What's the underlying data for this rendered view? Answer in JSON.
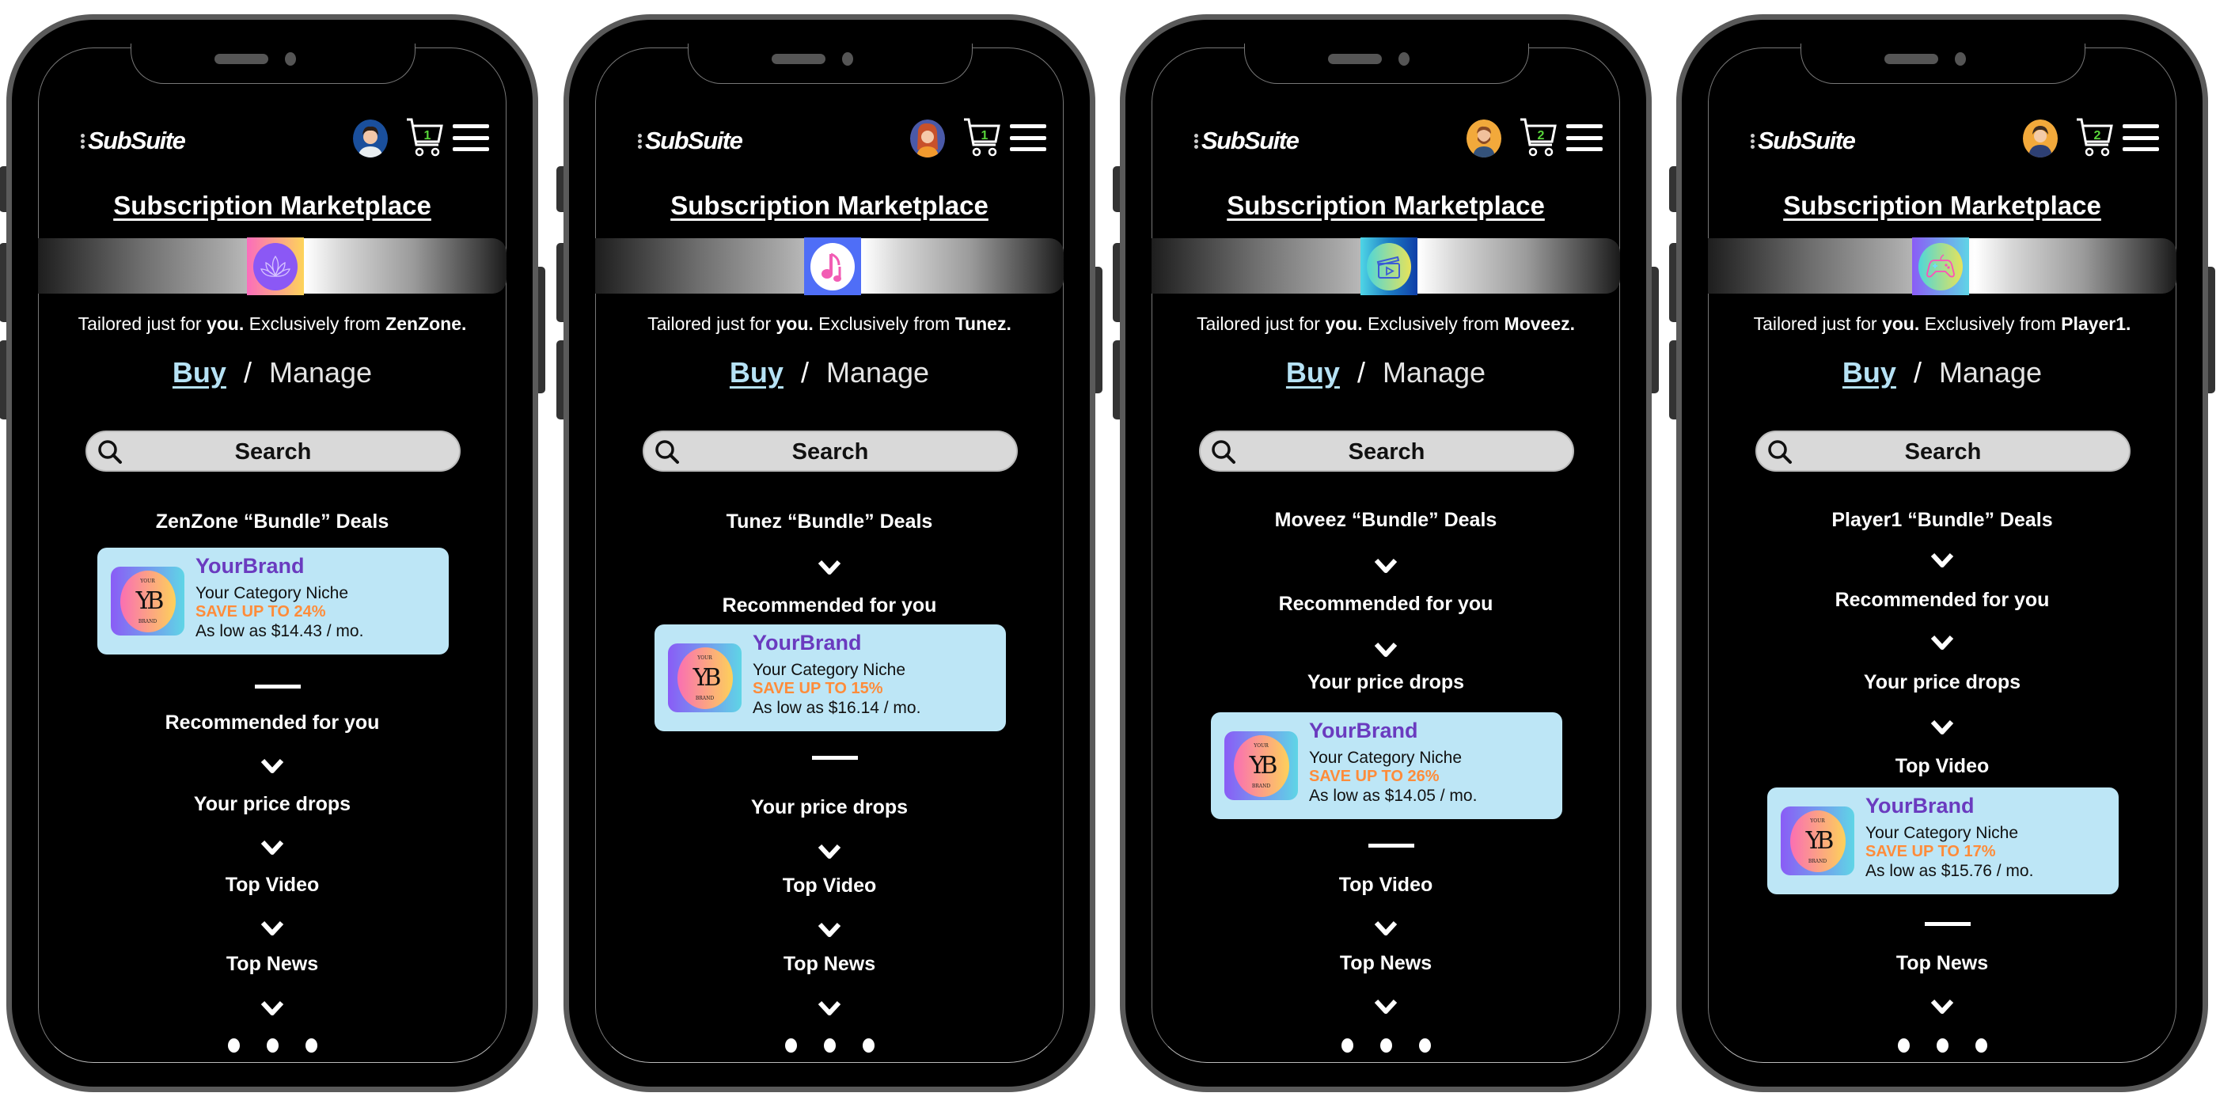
{
  "app": {
    "logo_text": "SubSuite",
    "page_title": "Subscription Marketplace",
    "tagline_prefix": "Tailored just for ",
    "tagline_you": "you.",
    "tagline_mid": " Exclusively from ",
    "tabs": {
      "buy": "Buy",
      "separator": "/",
      "manage": "Manage"
    },
    "search_placeholder": "Search",
    "colors": {
      "card_bg": "#bde6f6",
      "brand_purple": "#6a3bbf",
      "save_orange": "#ff8c3a",
      "buy_blue": "#b6e2f5",
      "cart_badge_green": "#58d63a"
    }
  },
  "phones": [
    {
      "provider": "ZenZone",
      "provider_suffix": ".",
      "banner_icon": "lotus-icon",
      "avatar": "avatar-man-blue",
      "cart_count": "1",
      "sections": {
        "bundle": "ZenZone “Bundle” Deals",
        "recommended": "Recommended for you",
        "price_drops": "Your price drops",
        "top_video": "Top Video",
        "top_news": "Top News"
      },
      "expanded_section": "bundle",
      "card": {
        "brand": "YourBrand",
        "niche": "Your Category Niche",
        "save": "SAVE UP TO 24%",
        "price": "As low as $14.43 / mo.",
        "logo_top": "YOUR",
        "logo_mid": "YB",
        "logo_bottom": "BRAND"
      }
    },
    {
      "provider": "Tunez",
      "provider_suffix": ".",
      "banner_icon": "music-note-icon",
      "avatar": "avatar-woman-redhair",
      "cart_count": "1",
      "sections": {
        "bundle": "Tunez “Bundle” Deals",
        "recommended": "Recommended for you",
        "price_drops": "Your price drops",
        "top_video": "Top Video",
        "top_news": "Top News"
      },
      "expanded_section": "recommended",
      "card": {
        "brand": "YourBrand",
        "niche": "Your Category Niche",
        "save": "SAVE UP TO 15%",
        "price": "As low as $16.14 / mo.",
        "logo_top": "YOUR",
        "logo_mid": "YB",
        "logo_bottom": "BRAND"
      }
    },
    {
      "provider": "Moveez",
      "provider_suffix": ".",
      "banner_icon": "clapperboard-icon",
      "avatar": "avatar-man-beard",
      "cart_count": "2",
      "sections": {
        "bundle": "Moveez “Bundle” Deals",
        "recommended": "Recommended for you",
        "price_drops": "Your price drops",
        "top_video": "Top Video",
        "top_news": "Top News"
      },
      "expanded_section": "price_drops",
      "card": {
        "brand": "YourBrand",
        "niche": "Your Category Niche",
        "save": "SAVE UP TO 26%",
        "price": "As low as $14.05 / mo.",
        "logo_top": "YOUR",
        "logo_mid": "YB",
        "logo_bottom": "BRAND"
      }
    },
    {
      "provider": "Player1",
      "provider_suffix": ".",
      "banner_icon": "gamepad-icon",
      "avatar": "avatar-man-hoodie",
      "cart_count": "2",
      "sections": {
        "bundle": "Player1 “Bundle” Deals",
        "recommended": "Recommended for you",
        "price_drops": "Your price drops",
        "top_video": "Top Video",
        "top_news": "Top News"
      },
      "expanded_section": "top_video",
      "card": {
        "brand": "YourBrand",
        "niche": "Your Category Niche",
        "save": "SAVE UP TO 17%",
        "price": "As low as $15.76 / mo.",
        "logo_top": "YOUR",
        "logo_mid": "YB",
        "logo_bottom": "BRAND"
      }
    }
  ]
}
